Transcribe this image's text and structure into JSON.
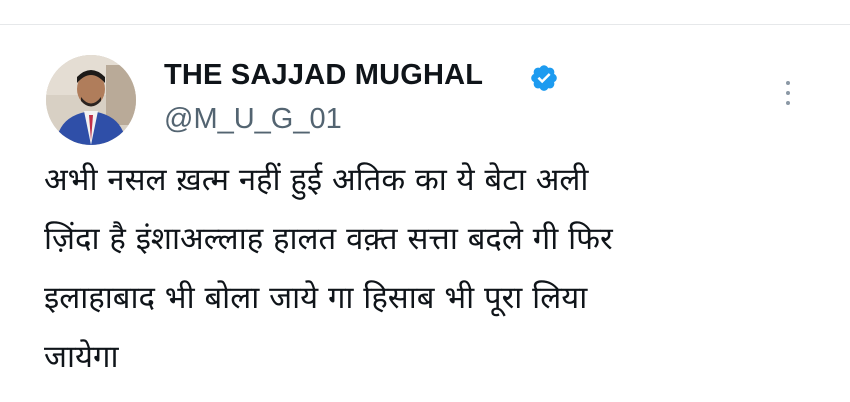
{
  "tweet": {
    "author": {
      "display_name": "THE SAJJAD MUGHAL",
      "handle": "@M_U_G_01",
      "verified": true
    },
    "text": "अभी नसल ख़त्म नहीं हुई अतिक का ये बेटा अली\nज़िंदा है इंशाअल्लाह हालत वक़्त सत्ता बदले गी फिर\nइलाहाबाद भी बोला जाये गा हिसाब भी पूरा लिया\nजायेगा"
  },
  "icons": {
    "verified": "verified-badge-icon",
    "more": "more-options-icon"
  },
  "colors": {
    "verified_blue": "#1d9bf0",
    "text_primary": "#0f1419",
    "text_secondary": "#536471"
  }
}
